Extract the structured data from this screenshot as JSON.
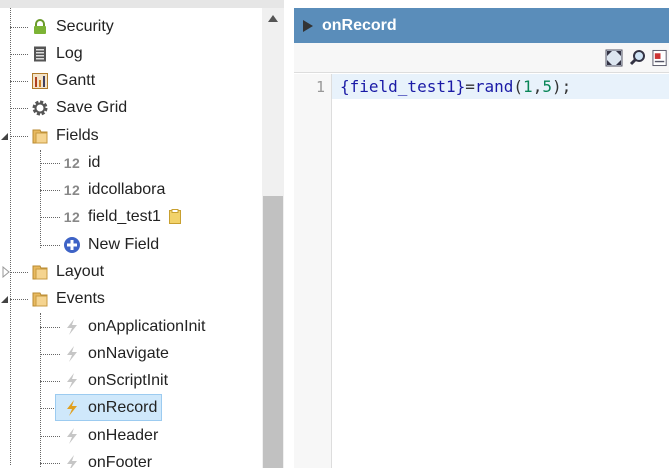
{
  "tree": {
    "items": [
      {
        "label": "Security",
        "icon": "lock-icon",
        "level": 0
      },
      {
        "label": "Log",
        "icon": "log-list-icon",
        "level": 0
      },
      {
        "label": "Gantt",
        "icon": "gantt-chart-icon",
        "level": 0
      },
      {
        "label": "Save Grid",
        "icon": "gear-icon",
        "level": 0
      },
      {
        "label": "Fields",
        "icon": "folder-icon",
        "level": 0,
        "expanded": true
      },
      {
        "label": "id",
        "icon": "numeric-field-icon",
        "badge": "12",
        "level": 1
      },
      {
        "label": "idcollabora",
        "icon": "numeric-field-icon",
        "badge": "12",
        "level": 1
      },
      {
        "label": "field_test1",
        "icon": "numeric-field-icon",
        "badge": "12",
        "level": 1,
        "extra_icon": "clipboard-icon"
      },
      {
        "label": "New Field",
        "icon": "add-circle-icon",
        "level": 1
      },
      {
        "label": "Layout",
        "icon": "folder-icon",
        "level": 0,
        "expanded": false
      },
      {
        "label": "Events",
        "icon": "folder-icon",
        "level": 0,
        "expanded": true
      },
      {
        "label": "onApplicationInit",
        "icon": "lightning-icon",
        "level": 1
      },
      {
        "label": "onNavigate",
        "icon": "lightning-icon",
        "level": 1
      },
      {
        "label": "onScriptInit",
        "icon": "lightning-icon",
        "level": 1
      },
      {
        "label": "onRecord",
        "icon": "lightning-icon",
        "level": 1,
        "selected": true
      },
      {
        "label": "onHeader",
        "icon": "lightning-icon",
        "level": 1
      },
      {
        "label": "onFooter",
        "icon": "lightning-icon",
        "level": 1
      }
    ]
  },
  "editor": {
    "title": "onRecord",
    "toolbar": [
      {
        "name": "fullscreen-icon"
      },
      {
        "name": "search-icon"
      },
      {
        "name": "preview-icon"
      }
    ],
    "line_number": "1",
    "code": {
      "var": "{field_test1}",
      "eq": "=",
      "fn": "rand",
      "open": "(",
      "arg1": "1",
      "comma": ",",
      "arg2": "5",
      "close": ");"
    }
  },
  "colors": {
    "header_bg": "#5a8dba",
    "selection_bg": "#cfe8fb",
    "code_line_bg": "#e8f2fb"
  }
}
